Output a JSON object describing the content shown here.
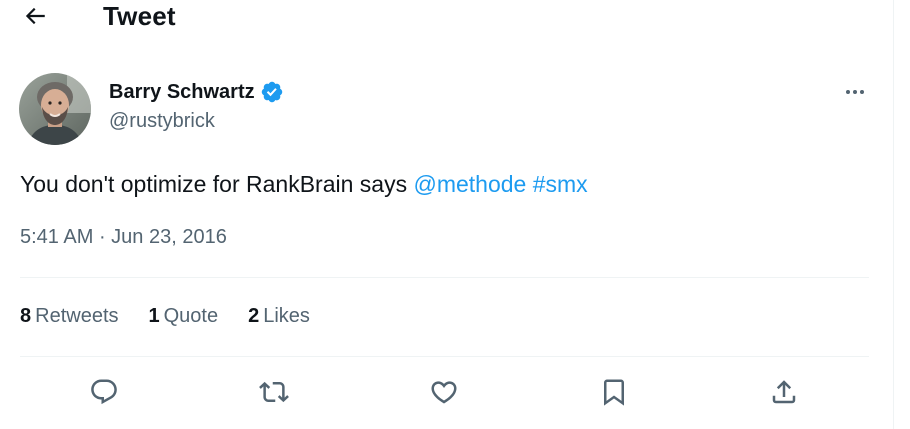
{
  "header": {
    "title": "Tweet"
  },
  "author": {
    "name": "Barry Schwartz",
    "handle": "@rustybrick",
    "verified_color": "#1d9bf0"
  },
  "tweet": {
    "text": "You don't optimize for RankBrain says ",
    "mention": "@methode",
    "hashtag": "#smx",
    "time": "5:41 AM",
    "separator": " · ",
    "date": "Jun 23, 2016"
  },
  "stats": {
    "retweets_count": "8",
    "retweets_label": "Retweets",
    "quotes_count": "1",
    "quotes_label": "Quote",
    "likes_count": "2",
    "likes_label": "Likes"
  },
  "actions": {
    "reply_icon": "reply-icon",
    "retweet_icon": "retweet-icon",
    "like_icon": "like-icon",
    "bookmark_icon": "bookmark-icon",
    "share_icon": "share-icon"
  },
  "colors": {
    "text_primary": "#0f1419",
    "text_secondary": "#536471",
    "accent": "#1d9bf0",
    "divider": "#eff3f4"
  }
}
